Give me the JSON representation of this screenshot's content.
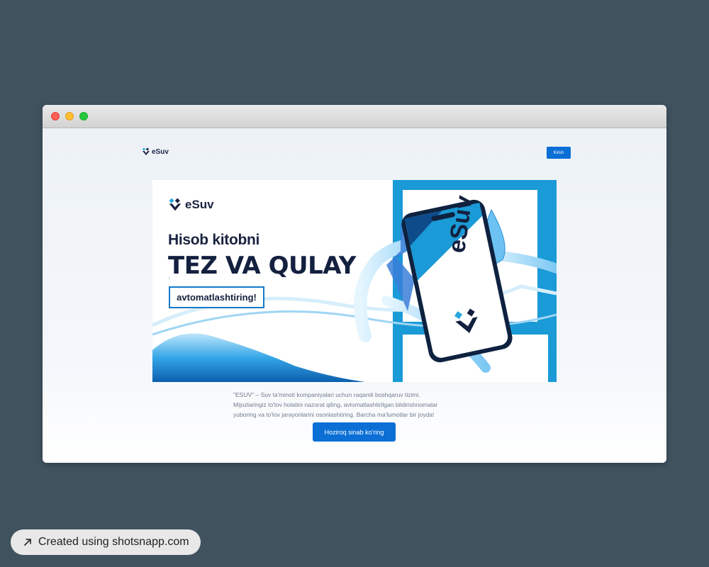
{
  "window": {
    "controls": [
      "close",
      "minimize",
      "maximize"
    ]
  },
  "navbar": {
    "logo_text": "eSuv",
    "login_label": "Kirish"
  },
  "banner": {
    "logo_text": "eSuv",
    "headline_line1": "Hisob kitobni",
    "headline_line2": "TEZ VA QULAY",
    "headline_boxed": "avtomatlashtiring!",
    "phone_brand": "eSuv"
  },
  "hero": {
    "description_line1": "\"ESUV\" – Suv ta'minoti kompaniyalari uchun raqamli boshqaruv tizimi.",
    "description_line2": "Mijozlaringiz to'lov holatini nazorat qiling, avtomatlashtirilgan bildirishnomalar",
    "description_line3": "yuboring va to'lov jarayonlarini osonlashtiring. Barcha ma'lumotlar bir joyda!",
    "cta_label": "Hoziroq sinab ko'ring"
  },
  "footer_badge": {
    "icon": "arrow-up-right-icon",
    "text": "Created using shotsnapp.com"
  },
  "colors": {
    "background": "#3f525e",
    "accent": "#0b6fd6",
    "brand_dark": "#14203f",
    "brand_light_blue": "#1a9ad6"
  }
}
